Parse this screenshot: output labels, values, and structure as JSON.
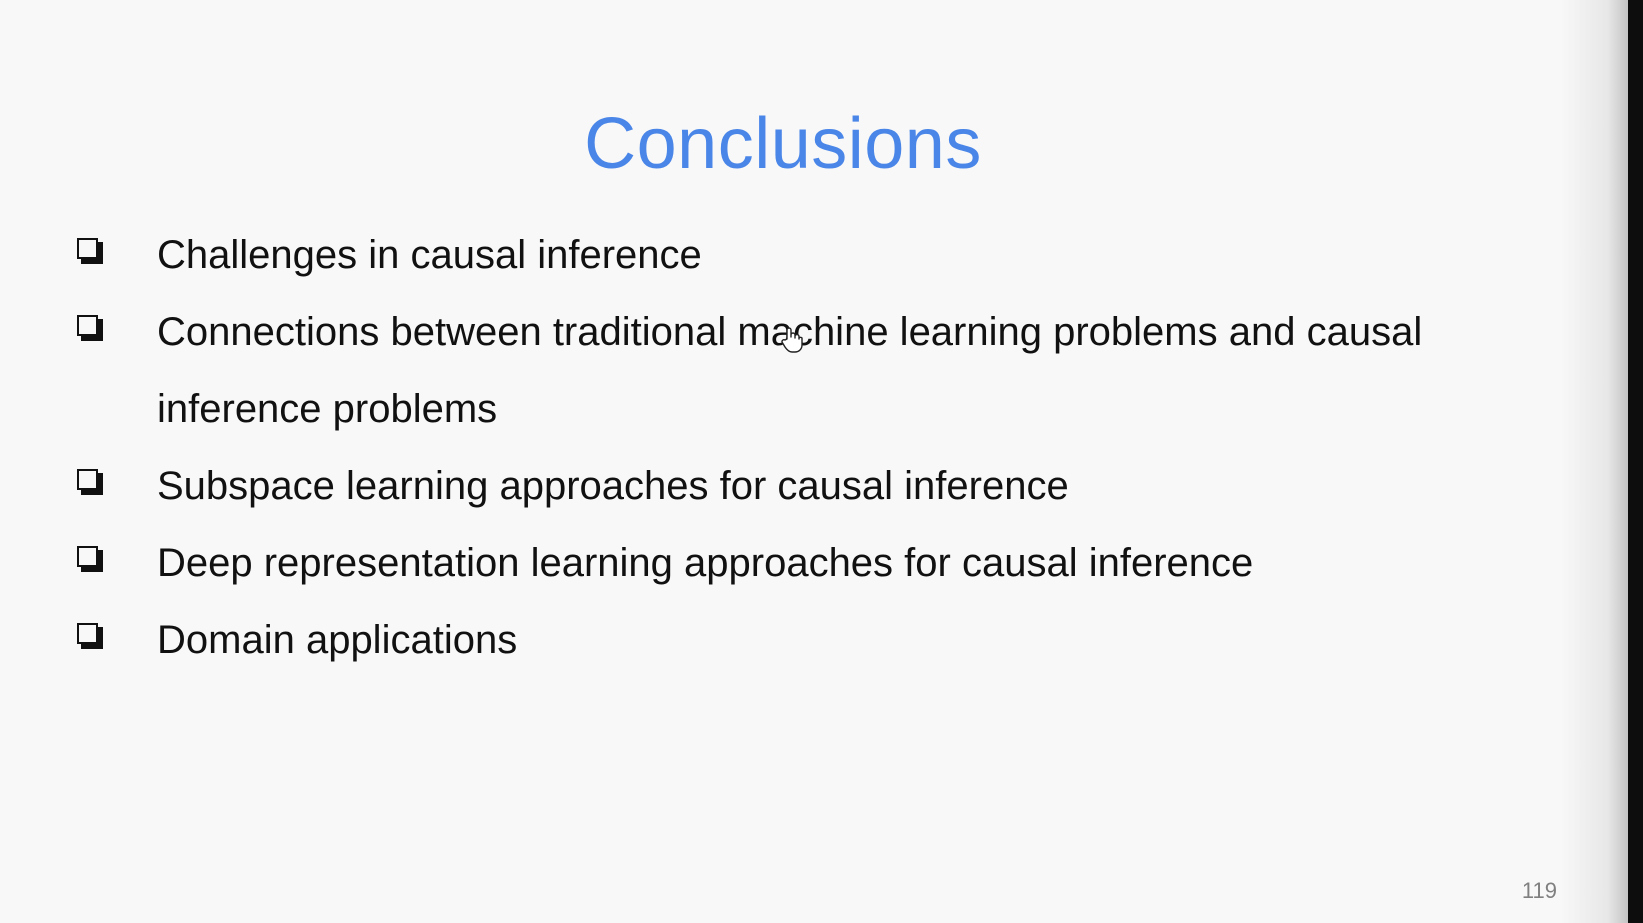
{
  "slide": {
    "title": "Conclusions",
    "bullets": [
      {
        "text": "Challenges in causal inference"
      },
      {
        "text": "Connections between traditional machine learning problems and causal inference problems"
      },
      {
        "text": "Subspace learning approaches for causal inference"
      },
      {
        "text": "Deep representation learning approaches for causal inference"
      },
      {
        "text": "Domain applications"
      }
    ],
    "page_number": "119"
  },
  "icons": {
    "bullet": "checkbox-shadow-icon",
    "cursor": "hand-pointer-icon"
  },
  "colors": {
    "title": "#4a86e8",
    "background": "#f8f8f8",
    "text": "#111111",
    "page_number": "#808080"
  }
}
